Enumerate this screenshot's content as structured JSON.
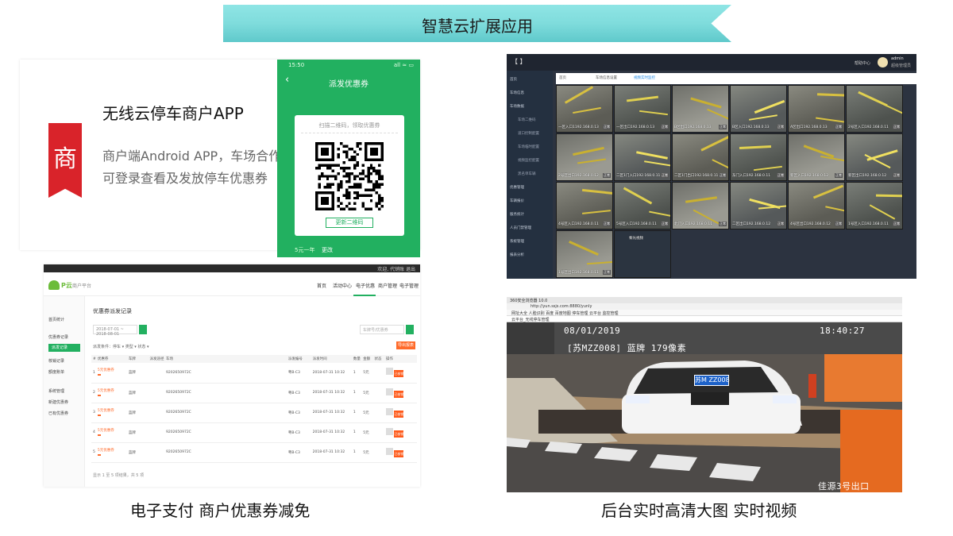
{
  "banner": {
    "title": "智慧云扩展应用"
  },
  "app": {
    "title": "无线云停车商户APP",
    "desc_line1": "商户端Android APP，车场合作商户",
    "desc_line2": "可登录查看及发放停车优惠券",
    "badge_char": "商",
    "phone": {
      "status_time": "15:50",
      "status_right": "all ≈ ▭",
      "back": "‹",
      "page_title": "派发优惠券",
      "scan_hint": "扫描二维码，领取优惠券",
      "refresh_label": "更新二维码",
      "footer_price": "5元一年",
      "footer_change": "更改"
    }
  },
  "web": {
    "topbar_right": "欢迎, 代销账  退出",
    "logo": "P云",
    "platform": "商户平台",
    "nav": [
      "首页",
      "活动中心",
      "电子优惠",
      "商户管理",
      "电子管理"
    ],
    "sidebar": [
      {
        "label": "首页统计",
        "active": false
      },
      {
        "label": "优惠券记录",
        "active": false
      },
      {
        "label": "派发记录",
        "active": true
      },
      {
        "label": "核销记录",
        "active": false
      },
      {
        "label": "额度账单",
        "active": false
      },
      {
        "label": "系统管理",
        "active": false
      },
      {
        "label": "新建优惠券",
        "active": false
      },
      {
        "label": "已有优惠券",
        "active": false
      }
    ],
    "section_title": "优惠券派发记录",
    "date_range": "2018-07-01 ~ 2018-08-01",
    "search_placeholder": "车牌号/优惠券",
    "filter_text": "派发条件：停车 ▾  类型 ▾  状态 ▾",
    "export_label": "导出报表",
    "columns": [
      "#",
      "优惠券",
      "车牌",
      "派发途径",
      "车场",
      "派发编号",
      "派发时间",
      "数量",
      "金额",
      "状态",
      "操作"
    ],
    "rows": [
      {
        "idx": "1",
        "coupon": "5元优惠券",
        "plate": "蓝牌",
        "channel": "",
        "lot": "9202650972C",
        "code": "粤B·C3",
        "time": "2018-07-31 10:32",
        "qty": "1",
        "amt": "5元",
        "status": "",
        "op": "已核销"
      },
      {
        "idx": "2",
        "coupon": "5元优惠券",
        "plate": "蓝牌",
        "channel": "",
        "lot": "9202650972C",
        "code": "粤B·C3",
        "time": "2018-07-31 10:32",
        "qty": "1",
        "amt": "5元",
        "status": "",
        "op": "已核销"
      },
      {
        "idx": "3",
        "coupon": "5元优惠券",
        "plate": "蓝牌",
        "channel": "",
        "lot": "9202650972C",
        "code": "粤B·C3",
        "time": "2018-07-31 10:32",
        "qty": "1",
        "amt": "5元",
        "status": "",
        "op": "已核销"
      },
      {
        "idx": "4",
        "coupon": "5元优惠券",
        "plate": "蓝牌",
        "channel": "",
        "lot": "9202650972C",
        "code": "粤B·C3",
        "time": "2018-07-31 10:32",
        "qty": "1",
        "amt": "5元",
        "status": "",
        "op": "已核销"
      },
      {
        "idx": "5",
        "coupon": "5元优惠券",
        "plate": "蓝牌",
        "channel": "",
        "lot": "9202650972C",
        "code": "粤B·C3",
        "time": "2018-07-31 10:32",
        "qty": "1",
        "amt": "5元",
        "status": "",
        "op": "已核销"
      }
    ],
    "pagination": "显示 1 至 5 项结果，共 5 项"
  },
  "captions": {
    "left": "电子支付    商户优惠券减免",
    "right": "后台实时高清大图 实时视频"
  },
  "videowall": {
    "title": "【                    】",
    "user": "admin",
    "user_sub": "超级管理员",
    "help": "帮助中心",
    "menu": [
      "首页",
      "车场信息",
      "车场数据",
      "车场二维码",
      "道口控制配置",
      "车场临时配置",
      "视频监控配置",
      "黑名单车辆",
      "优惠管理",
      "车辆报价",
      "服务统计",
      "人员门禁管理",
      "系统管理",
      "报表分析"
    ],
    "menu_sub": [
      false,
      false,
      false,
      true,
      true,
      true,
      true,
      true,
      false,
      false,
      false,
      false,
      false,
      false
    ],
    "tabs": [
      "首页",
      "车场信息设置",
      "视频实时监控"
    ],
    "cells": [
      "一区入口1192.168.0.13",
      "一区出口192.168.0.13",
      "B区出口192.168.0.13",
      "B区入口192.168.0.13",
      "A区出口192.168.0.13",
      "2号区入口192.168.0.11",
      "2号区出口192.168.0.12",
      "二区1门入口192.168.0.11",
      "二区1门出口192.168.0.11",
      "东门入口192.168.0.11",
      "新区入口192.168.0.12",
      "新区出口192.168.0.12",
      "4号区入口192.168.0.11",
      "5号区入口192.168.0.11",
      "北门入口192.168.0.11",
      "二区出口192.168.0.12",
      "4号区出口192.168.0.12",
      "1号区入口192.168.0.11",
      "1号区出口192.168.0.11",
      "黎光视频"
    ],
    "cell_tag": "正常"
  },
  "gate": {
    "browser_title": "360安全浏览器 10.0",
    "url": "http://yun.ssjs.com:8880/yunly",
    "bookmarks": "网址大全  人脸识别  百度  百度地图  停车管理  云平台  监控管理",
    "tabs": "云平台_无线停车管理",
    "date": "08/01/2019",
    "time": "18:40:27",
    "plate_info": "[苏MZZ008] 蓝牌 179像素",
    "plate": "苏M ZZ008",
    "exit_label": "佳源3号出口",
    "colors": {
      "plate_bg": "#1e62c8"
    }
  }
}
